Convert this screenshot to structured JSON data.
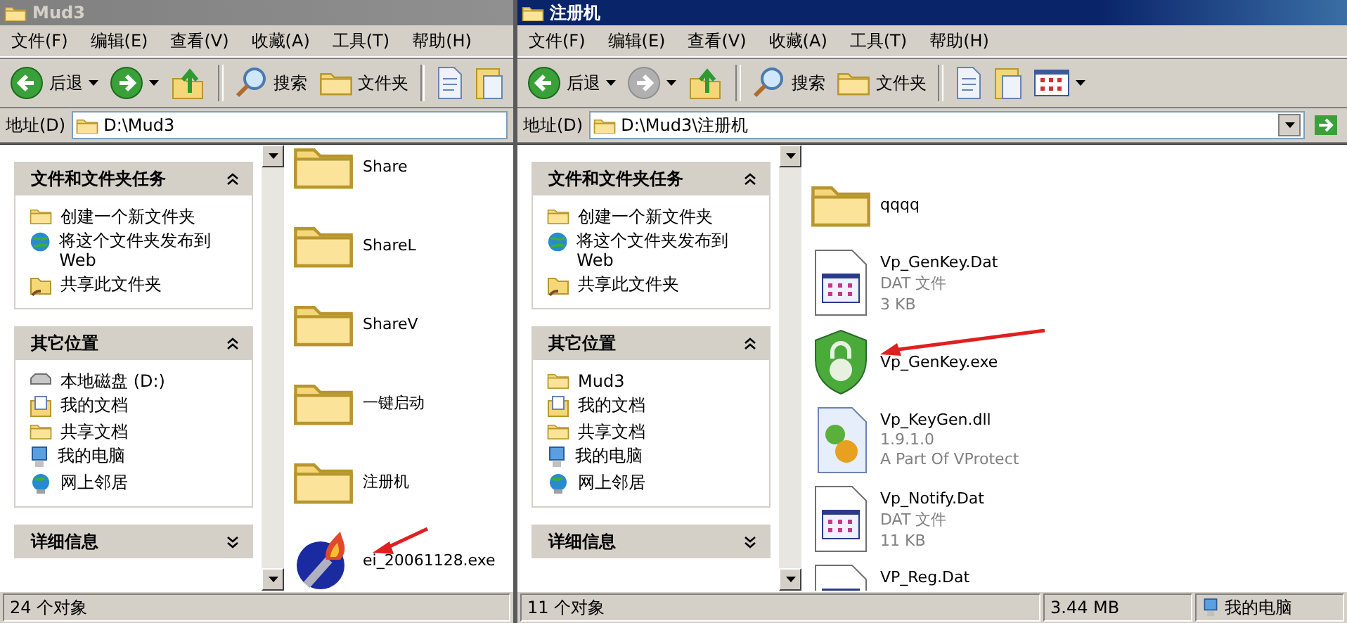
{
  "windows": [
    {
      "title": "Mud3",
      "active": false,
      "menu": [
        "文件(F)",
        "编辑(E)",
        "查看(V)",
        "收藏(A)",
        "工具(T)",
        "帮助(H)"
      ],
      "toolbar": [
        {
          "kind": "back",
          "label": "后退",
          "disabled": false
        },
        {
          "kind": "forward",
          "disabled": false
        },
        {
          "kind": "up"
        },
        {
          "kind": "search",
          "label": "搜索"
        },
        {
          "kind": "folders",
          "label": "文件夹"
        },
        {
          "kind": "copy"
        },
        {
          "kind": "paste"
        }
      ],
      "address": {
        "label": "地址(D)",
        "value": "D:\\Mud3",
        "go_button": false
      },
      "sidebar": [
        {
          "title": "文件和文件夹任务",
          "expanded": true,
          "items": [
            {
              "kind": "new-folder",
              "label": "创建一个新文件夹"
            },
            {
              "kind": "publish",
              "label": "将这个文件夹发布到 Web"
            },
            {
              "kind": "share",
              "label": "共享此文件夹"
            }
          ]
        },
        {
          "title": "其它位置",
          "expanded": true,
          "items": [
            {
              "kind": "drive",
              "label": "本地磁盘 (D:)"
            },
            {
              "kind": "documents",
              "label": "我的文档"
            },
            {
              "kind": "folder",
              "label": "共享文档"
            },
            {
              "kind": "computer",
              "label": "我的电脑"
            },
            {
              "kind": "network",
              "label": "网上邻居"
            }
          ]
        },
        {
          "title": "详细信息",
          "expanded": false
        }
      ],
      "files": [
        {
          "kind": "folder",
          "name": "Share",
          "marked": false
        },
        {
          "kind": "folder",
          "name": "ShareL",
          "marked": false
        },
        {
          "kind": "folder",
          "name": "ShareV",
          "marked": false
        },
        {
          "kind": "folder",
          "name": "一键启动",
          "marked": false
        },
        {
          "kind": "folder",
          "name": "注册机",
          "marked": false
        },
        {
          "kind": "torch",
          "name": "ei_20061128.exe",
          "marked": true
        }
      ],
      "status": [
        "24 个对象"
      ]
    },
    {
      "title": "注册机",
      "active": true,
      "menu": [
        "文件(F)",
        "编辑(E)",
        "查看(V)",
        "收藏(A)",
        "工具(T)",
        "帮助(H)"
      ],
      "toolbar": [
        {
          "kind": "back",
          "label": "后退",
          "disabled": false
        },
        {
          "kind": "forward",
          "disabled": true
        },
        {
          "kind": "up"
        },
        {
          "kind": "search",
          "label": "搜索"
        },
        {
          "kind": "folders",
          "label": "文件夹"
        },
        {
          "kind": "copy"
        },
        {
          "kind": "paste"
        },
        {
          "kind": "views"
        }
      ],
      "address": {
        "label": "地址(D)",
        "value": "D:\\Mud3\\注册机",
        "go_button": true
      },
      "sidebar": [
        {
          "title": "文件和文件夹任务",
          "expanded": true,
          "items": [
            {
              "kind": "new-folder",
              "label": "创建一个新文件夹"
            },
            {
              "kind": "publish",
              "label": "将这个文件夹发布到 Web"
            },
            {
              "kind": "share",
              "label": "共享此文件夹"
            }
          ]
        },
        {
          "title": "其它位置",
          "expanded": true,
          "items": [
            {
              "kind": "folder",
              "label": "Mud3"
            },
            {
              "kind": "documents",
              "label": "我的文档"
            },
            {
              "kind": "folder",
              "label": "共享文档"
            },
            {
              "kind": "computer",
              "label": "我的电脑"
            },
            {
              "kind": "network",
              "label": "网上邻居"
            }
          ]
        },
        {
          "title": "详细信息",
          "expanded": false
        }
      ],
      "files": [
        {
          "kind": "folder",
          "name": "qqqq",
          "marked": false
        },
        {
          "kind": "dat",
          "name": "Vp_GenKey.Dat",
          "details": [
            "DAT 文件",
            "3 KB"
          ],
          "marked": false
        },
        {
          "kind": "shield",
          "name": "Vp_GenKey.exe",
          "marked": true
        },
        {
          "kind": "dll",
          "name": "Vp_KeyGen.dll",
          "details": [
            "1.9.1.0",
            "A Part Of VProtect"
          ],
          "marked": false
        },
        {
          "kind": "dat",
          "name": "Vp_Notify.Dat",
          "details": [
            "DAT 文件",
            "11 KB"
          ],
          "marked": false
        },
        {
          "kind": "dat",
          "name": "VP_Reg.Dat",
          "marked": false
        }
      ],
      "status": [
        "11 个对象",
        "3.44 MB",
        "我的电脑"
      ]
    }
  ]
}
